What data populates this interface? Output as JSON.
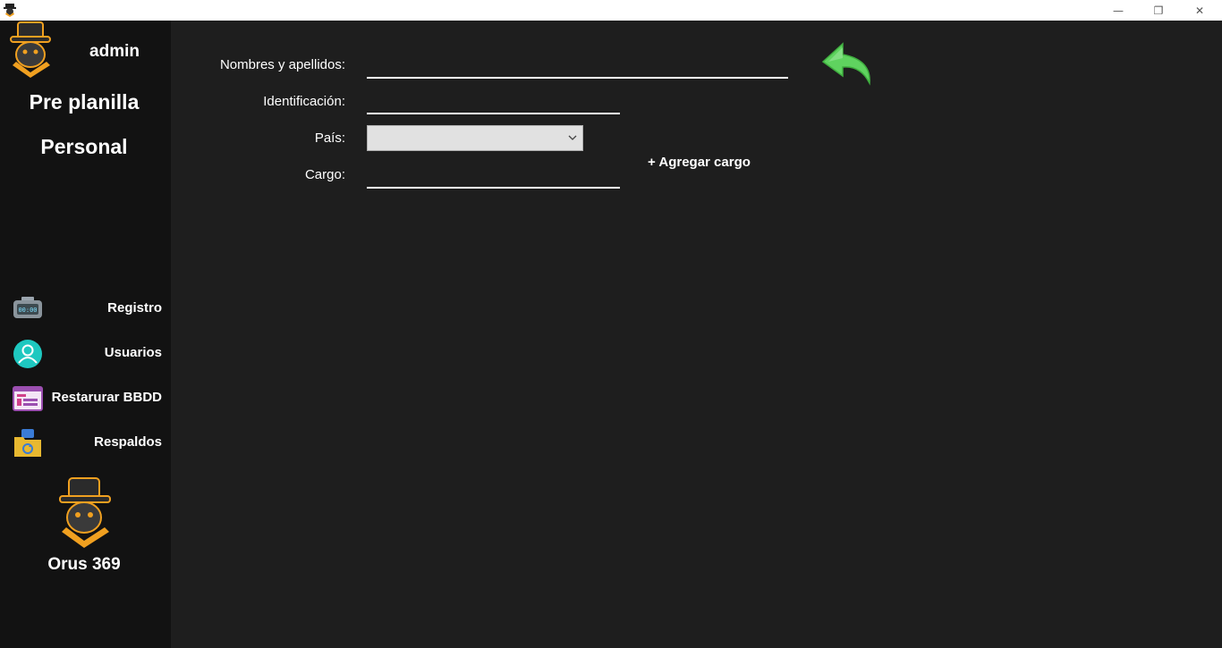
{
  "titlebar": {
    "minimize_glyph": "—",
    "maximize_glyph": "❐",
    "close_glyph": "✕"
  },
  "sidebar": {
    "user": "admin",
    "title_1": "Pre planilla",
    "title_2": "Personal",
    "items": [
      {
        "label": "Registro",
        "icon": "clock-icon"
      },
      {
        "label": "Usuarios",
        "icon": "user-icon"
      },
      {
        "label": "Restarurar BBDD",
        "icon": "database-restore-icon"
      },
      {
        "label": "Respaldos",
        "icon": "backup-folder-icon"
      }
    ],
    "brand": "Orus 369",
    "clock_display": "00:00"
  },
  "form": {
    "nombres_label": "Nombres y apellidos:",
    "nombres_value": "",
    "identificacion_label": "Identificación:",
    "identificacion_value": "",
    "pais_label": "País:",
    "pais_value": "",
    "cargo_label": "Cargo:",
    "cargo_value": "",
    "add_cargo_label": "+ Agregar cargo"
  },
  "colors": {
    "background": "#1e1e1e",
    "sidebar": "#121212",
    "accent_green": "#5fd35f",
    "logo_orange": "#f0a020"
  }
}
